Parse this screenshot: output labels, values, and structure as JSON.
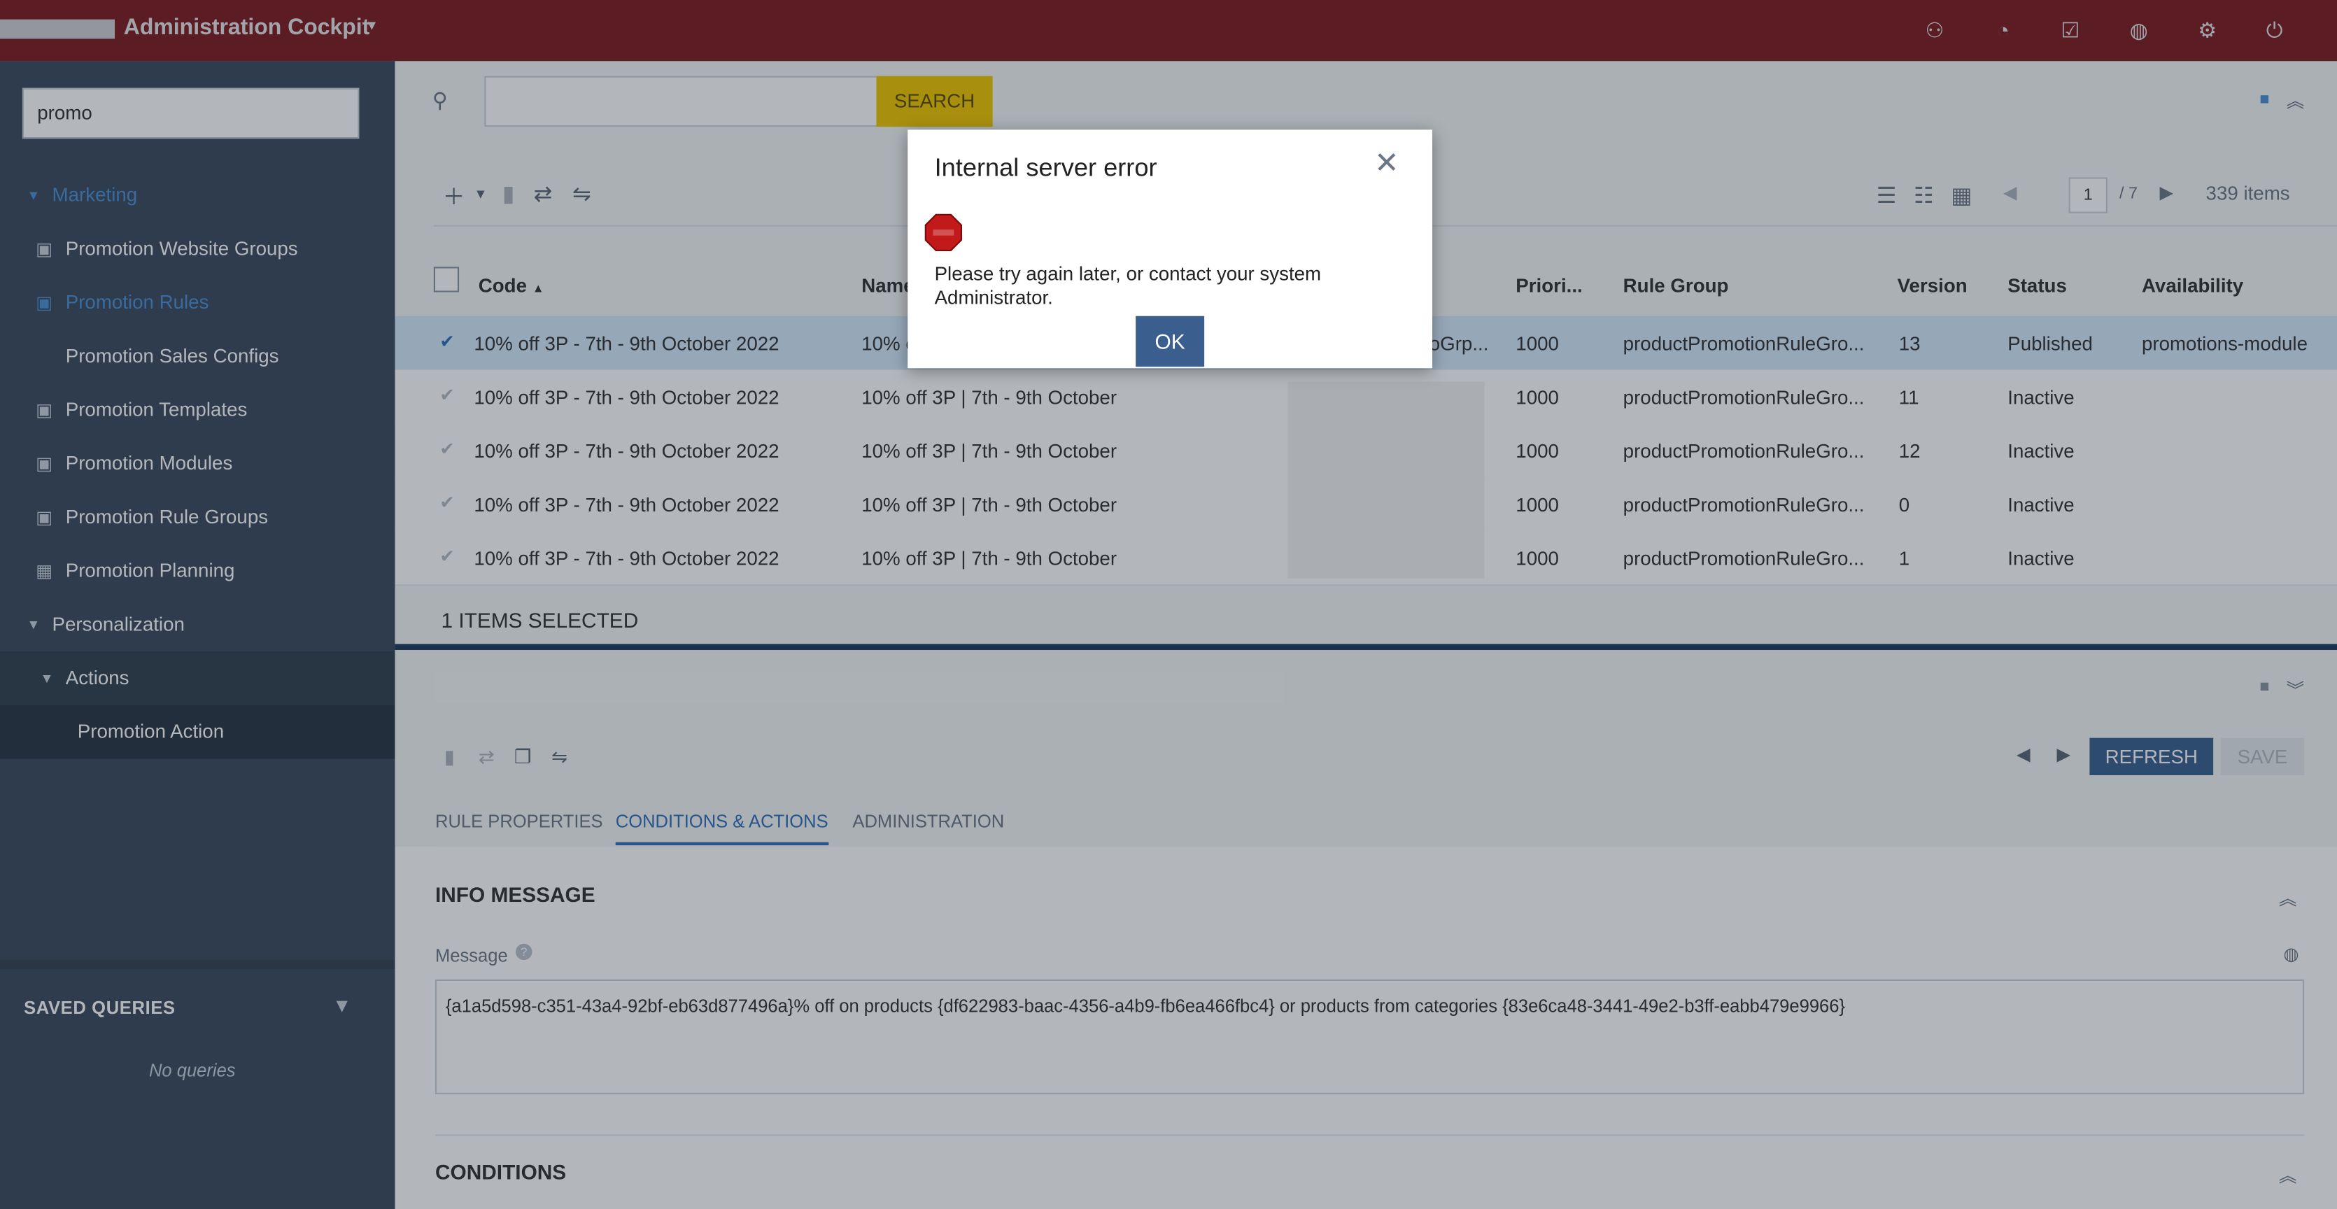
{
  "app": {
    "title": "Administration Cockpit"
  },
  "topbar": {
    "icons": [
      "users-icon",
      "notification-icon",
      "tasks-icon",
      "globe-icon",
      "settings-icon",
      "power-icon"
    ]
  },
  "sidebar": {
    "search_value": "promo",
    "items": [
      {
        "label": "Marketing"
      },
      {
        "label": "Promotion Website Groups"
      },
      {
        "label": "Promotion Rules"
      },
      {
        "label": "Promotion Sales Configs"
      },
      {
        "label": "Promotion Templates"
      },
      {
        "label": "Promotion Modules"
      },
      {
        "label": "Promotion Rule Groups"
      },
      {
        "label": "Promotion Planning"
      },
      {
        "label": "Personalization"
      },
      {
        "label": "Actions"
      },
      {
        "label": "Promotion Action"
      }
    ],
    "saved_queries_title": "SAVED QUERIES",
    "no_queries": "No queries"
  },
  "main": {
    "search_value": "",
    "search_button": "SEARCH",
    "page_current": "1",
    "page_total": "/ 7",
    "items_count": "339 items",
    "columns": {
      "code": "Code",
      "name": "Name",
      "priority": "Priori...",
      "rule_group": "Rule Group",
      "version": "Version",
      "status": "Status",
      "availability": "Availability"
    },
    "rows": [
      {
        "code": "10% off 3P - 7th - 9th October 2022",
        "name": "10% o",
        "extra": "oGrp...",
        "priority": "1000",
        "rule_group": "productPromotionRuleGro...",
        "version": "13",
        "status": "Published",
        "availability": "promotions-module"
      },
      {
        "code": "10% off 3P - 7th - 9th October 2022",
        "name": "10% off 3P | 7th - 9th October",
        "extra": "",
        "priority": "1000",
        "rule_group": "productPromotionRuleGro...",
        "version": "11",
        "status": "Inactive",
        "availability": ""
      },
      {
        "code": "10% off 3P - 7th - 9th October 2022",
        "name": "10% off 3P | 7th - 9th October",
        "extra": "",
        "priority": "1000",
        "rule_group": "productPromotionRuleGro...",
        "version": "12",
        "status": "Inactive",
        "availability": ""
      },
      {
        "code": "10% off 3P - 7th - 9th October 2022",
        "name": "10% off 3P | 7th - 9th October",
        "extra": "",
        "priority": "1000",
        "rule_group": "productPromotionRuleGro...",
        "version": "0",
        "status": "Inactive",
        "availability": ""
      },
      {
        "code": "10% off 3P - 7th - 9th October 2022",
        "name": "10% off 3P | 7th - 9th October",
        "extra": "",
        "priority": "1000",
        "rule_group": "productPromotionRuleGro...",
        "version": "1",
        "status": "Inactive",
        "availability": ""
      }
    ],
    "selected_text": "1 ITEMS SELECTED"
  },
  "detail": {
    "refresh_button": "REFRESH",
    "save_button": "SAVE",
    "tabs": [
      {
        "label": "RULE PROPERTIES"
      },
      {
        "label": "CONDITIONS & ACTIONS"
      },
      {
        "label": "ADMINISTRATION"
      }
    ],
    "info_message_title": "INFO MESSAGE",
    "message_label": "Message",
    "message_value": "{a1a5d598-c351-43a4-92bf-eb63d877496a}% off on products {df622983-baac-4356-a4b9-fb6ea466fbc4} or products from categories {83e6ca48-3441-49e2-b3ff-eabb479e9966}",
    "conditions_title": "CONDITIONS"
  },
  "modal": {
    "title": "Internal server error",
    "message": "Please try again later, or contact your system Administrator.",
    "ok_button": "OK"
  },
  "colors": {
    "topbar": "#8b1d1d",
    "sidebar": "#3c4a5e",
    "accent": "#2f6fb7",
    "search_button": "#f0c400",
    "primary_button": "#3a5f8f"
  }
}
